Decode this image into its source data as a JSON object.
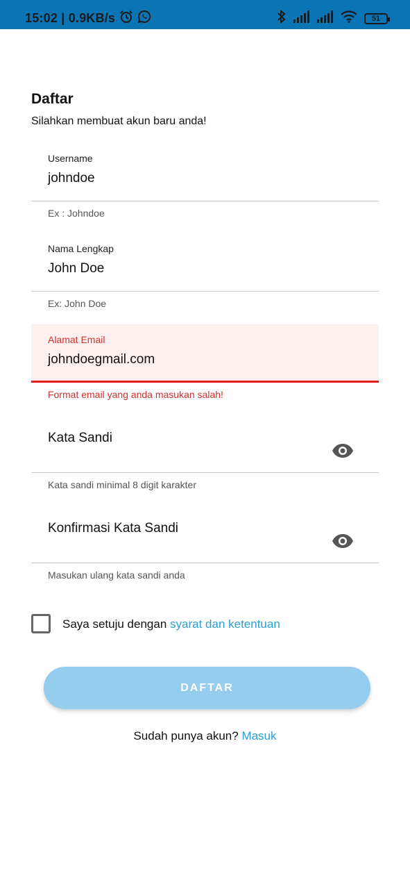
{
  "status_bar": {
    "time": "15:02",
    "separator": " | ",
    "speed": "0.9KB/s",
    "battery": "51",
    "icons": [
      "alarm-icon",
      "whatsapp-icon",
      "bluetooth-icon",
      "signal-icon",
      "signal-icon",
      "wifi-icon",
      "battery-icon"
    ]
  },
  "header": {
    "title": "Daftar",
    "subtitle": "Silahkan membuat akun baru anda!"
  },
  "form": {
    "username": {
      "label": "Username",
      "value": "johndoe",
      "helper": "Ex : Johndoe"
    },
    "fullname": {
      "label": "Nama Lengkap",
      "value": "John Doe",
      "helper": "Ex: John Doe"
    },
    "email": {
      "label": "Alamat Email",
      "value": "johndoegmail.com",
      "error": "Format email yang anda masukan salah!"
    },
    "password": {
      "label": "Kata Sandi",
      "helper": "Kata sandi minimal 8 digit karakter",
      "icon": "eye-icon"
    },
    "confirm_password": {
      "label": "Konfirmasi Kata Sandi",
      "helper": "Masukan ulang kata sandi anda",
      "icon": "eye-icon"
    }
  },
  "agreement": {
    "checked": false,
    "text": "Saya setuju dengan ",
    "link": "syarat dan ketentuan"
  },
  "submit": {
    "label": "DAFTAR"
  },
  "footer": {
    "text": "Sudah punya akun? ",
    "link": "Masuk"
  },
  "colors": {
    "status_bar": "#0a74b5",
    "error": "#d32f2f",
    "link": "#2a9fd0",
    "button": "#94cdee"
  }
}
